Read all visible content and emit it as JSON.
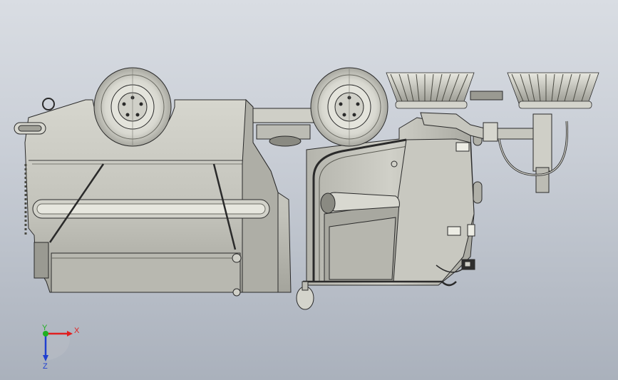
{
  "triad": {
    "x_label": "X",
    "y_label": "Y",
    "z_label": "Z",
    "x_color": "#e02020",
    "y_color": "#20b020",
    "z_color": "#2040d0"
  },
  "colors": {
    "background_top": "#d9dde3",
    "background_bottom": "#aab1bc",
    "body_fill": "#c4c4bc",
    "body_dark": "#9c9c94",
    "body_light": "#e4e4dc",
    "outline": "#2a2a2a"
  },
  "model": {
    "icons": [
      "rear-wheel-icon",
      "front-wheel-icon",
      "brush-left-icon",
      "brush-right-icon"
    ]
  }
}
